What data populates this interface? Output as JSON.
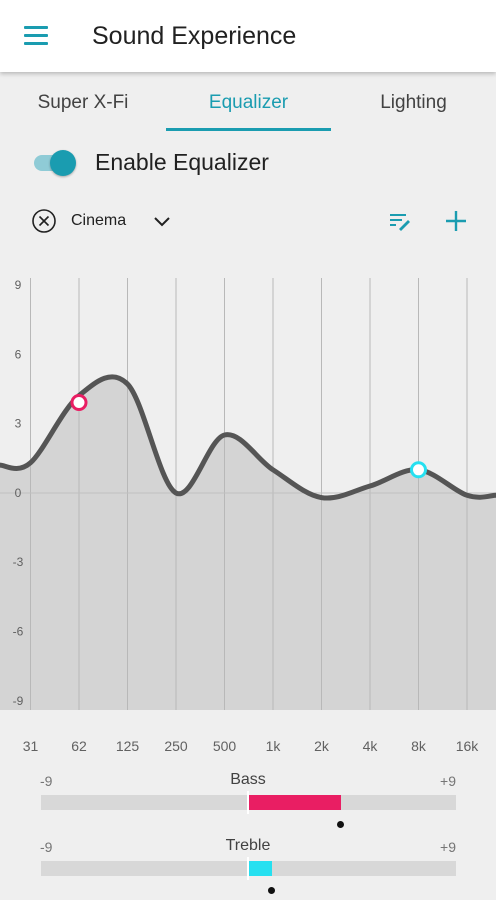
{
  "app": {
    "title": "Sound Experience",
    "accent_color": "#1a9cb0"
  },
  "tabs": [
    {
      "label": "Super X-Fi",
      "active": false
    },
    {
      "label": "Equalizer",
      "active": true
    },
    {
      "label": "Lighting",
      "active": false
    }
  ],
  "equalizer": {
    "toggle_label": "Enable Equalizer",
    "enabled": true,
    "preset": "Cinema",
    "y_ticks": [
      "9",
      "6",
      "3",
      "0",
      "-3",
      "-6",
      "-9"
    ],
    "bands": [
      "31",
      "62",
      "125",
      "250",
      "500",
      "1k",
      "2k",
      "4k",
      "8k",
      "16k"
    ],
    "gains_db": [
      1.3,
      4.2,
      4.7,
      0.0,
      2.5,
      1.0,
      -0.2,
      0.3,
      1.0,
      -0.1
    ],
    "selected_points": [
      {
        "band": "62",
        "gain_db": 3.9,
        "color": "#e91e63"
      },
      {
        "band": "8k",
        "gain_db": 1.0,
        "color": "#26e0f0"
      }
    ],
    "curve_color": "#555555",
    "fill_color": "#d4d4d4"
  },
  "bass": {
    "label": "Bass",
    "min": "-9",
    "max": "+9",
    "value": 4,
    "color": "#e91e63"
  },
  "treble": {
    "label": "Treble",
    "min": "-9",
    "max": "+9",
    "value": 1,
    "color": "#26e0f0"
  }
}
